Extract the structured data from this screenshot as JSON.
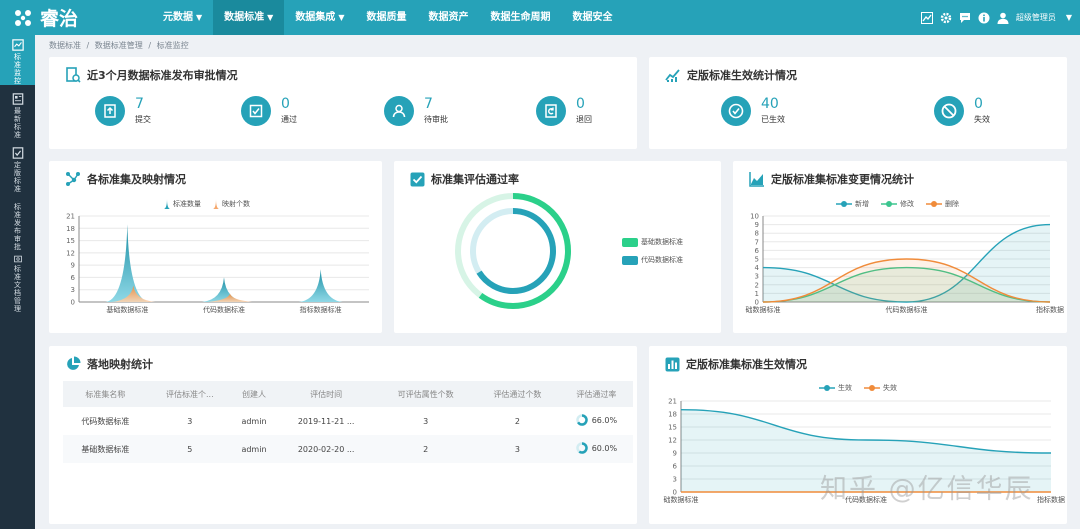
{
  "app": {
    "name": "睿治"
  },
  "nav": [
    {
      "label": "元数据",
      "dropdown": true
    },
    {
      "label": "数据标准",
      "dropdown": true,
      "active": true
    },
    {
      "label": "数据集成",
      "dropdown": true
    },
    {
      "label": "数据质量",
      "dropdown": false
    },
    {
      "label": "数据资产",
      "dropdown": false
    },
    {
      "label": "数据生命周期",
      "dropdown": false
    },
    {
      "label": "数据安全",
      "dropdown": false
    }
  ],
  "user": {
    "name": "超级管理员",
    "icons": [
      "chart-icon",
      "gear-icon",
      "message-icon",
      "info-icon",
      "user-icon"
    ]
  },
  "sidebar": [
    {
      "label": "标准监控",
      "icon": "monitor-icon",
      "active": true
    },
    {
      "label": "最新标准",
      "icon": "document-icon"
    },
    {
      "label": "定版标准",
      "icon": "check-document-icon"
    },
    {
      "label": "标准发布审批",
      "icon": "edit-document-icon"
    },
    {
      "label": "标准文档管理",
      "icon": "image-icon"
    }
  ],
  "breadcrumb": [
    "数据标准",
    "/",
    "数据标准管理",
    "/",
    "标准监控"
  ],
  "approval": {
    "title": "近3个月数据标准发布审批情况",
    "stats": [
      {
        "value": "7",
        "label": "提交",
        "icon": "upload-icon"
      },
      {
        "value": "0",
        "label": "通过",
        "icon": "check-icon"
      },
      {
        "value": "7",
        "label": "待审批",
        "icon": "person-icon"
      },
      {
        "value": "0",
        "label": "退回",
        "icon": "return-icon"
      }
    ]
  },
  "effective": {
    "title": "定版标准生效统计情况",
    "stats": [
      {
        "value": "40",
        "label": "已生效",
        "icon": "check-circle-icon"
      },
      {
        "value": "0",
        "label": "失效",
        "icon": "ban-icon"
      }
    ]
  },
  "mapping": {
    "title": "各标准集及映射情况",
    "chart_data": {
      "type": "bar",
      "categories": [
        "基础数据标准",
        "代码数据标准",
        "指标数据标准"
      ],
      "series": [
        {
          "name": "标准数量",
          "values": [
            19,
            6,
            8
          ],
          "color": "#26a2b8"
        },
        {
          "name": "映射个数",
          "values": [
            4,
            2,
            0
          ],
          "color": "#f5a76c"
        }
      ],
      "y_ticks": [
        "0",
        "3",
        "6",
        "9",
        "12",
        "15",
        "18",
        "21"
      ],
      "ylim": [
        0,
        21
      ]
    }
  },
  "pass_rate": {
    "title": "标准集评估通过率",
    "chart_data": {
      "type": "pie",
      "series": [
        {
          "name": "基础数据标准",
          "value": 60.0,
          "color": "#2bd08a"
        },
        {
          "name": "代码数据标准",
          "value": 66.0,
          "color": "#26a2b8"
        }
      ]
    }
  },
  "changes": {
    "title": "定版标准集标准变更情况统计",
    "chart_data": {
      "type": "line",
      "categories": [
        "基础数据标准",
        "代码数据标准",
        "指标数据标准"
      ],
      "category_labels": [
        "础数据标准",
        "代码数据标准",
        "指标数据"
      ],
      "series": [
        {
          "name": "新增",
          "values": [
            4,
            0,
            9
          ],
          "color": "#26a2b8"
        },
        {
          "name": "修改",
          "values": [
            0,
            4,
            0
          ],
          "color": "#3cc58f"
        },
        {
          "name": "删除",
          "values": [
            0,
            5,
            0
          ],
          "color": "#f08b3a"
        }
      ],
      "y_ticks": [
        "0",
        "1",
        "2",
        "3",
        "4",
        "5",
        "6",
        "7",
        "8",
        "9",
        "10"
      ],
      "ylim": [
        0,
        10
      ]
    }
  },
  "landing": {
    "title": "落地映射统计",
    "columns": [
      "标准集名称",
      "评估标准个...",
      "创建人",
      "评估时间",
      "可评估属性个数",
      "评估通过个数",
      "评估通过率"
    ],
    "rows": [
      {
        "name": "代码数据标准",
        "count": "3",
        "creator": "admin",
        "time": "2019-11-21 ...",
        "attrs": "3",
        "passed": "2",
        "rate": "66.0%",
        "rate_value": 66.0
      },
      {
        "name": "基础数据标准",
        "count": "5",
        "creator": "admin",
        "time": "2020-02-20 ...",
        "attrs": "2",
        "passed": "3",
        "rate": "60.0%",
        "rate_value": 60.0
      }
    ]
  },
  "effect": {
    "title": "定版标准集标准生效情况",
    "chart_data": {
      "type": "line",
      "categories": [
        "基础数据标准",
        "代码数据标准",
        "指标数据标准"
      ],
      "category_labels": [
        "础数据标准",
        "代码数据标准",
        "指标数据"
      ],
      "series": [
        {
          "name": "生效",
          "values": [
            19,
            12,
            9
          ],
          "color": "#26a2b8"
        },
        {
          "name": "失效",
          "values": [
            0,
            0,
            0
          ],
          "color": "#f08b3a"
        }
      ],
      "y_ticks": [
        "0",
        "3",
        "6",
        "9",
        "12",
        "15",
        "18",
        "21"
      ],
      "ylim": [
        0,
        21
      ]
    }
  },
  "watermark": "知乎 @亿信华辰"
}
